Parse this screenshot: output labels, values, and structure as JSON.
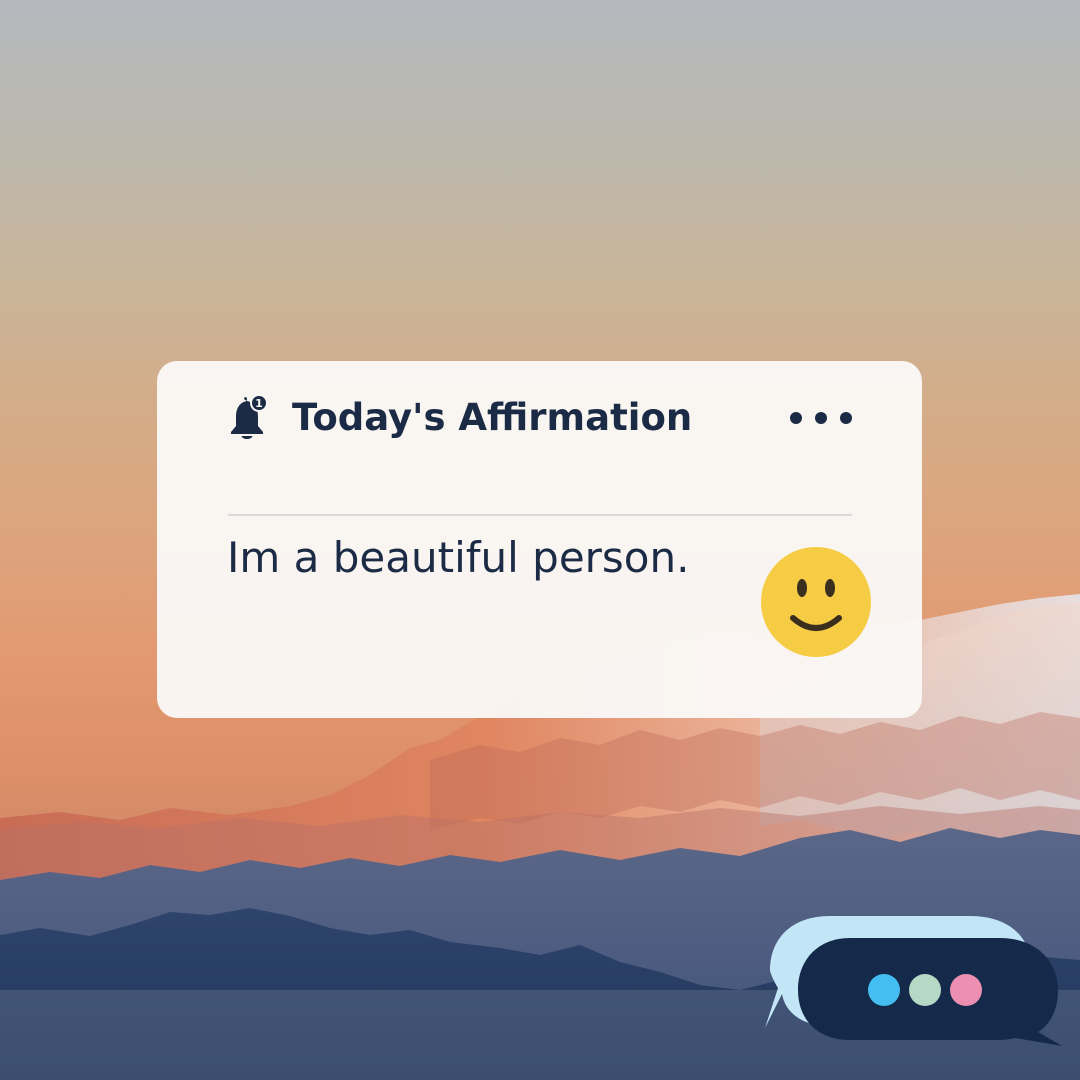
{
  "card": {
    "title": "Today's Affirmation",
    "message": "Im a beautiful person.",
    "notification_count": "1"
  },
  "icons": {
    "bell": "bell-icon",
    "more": "more-horizontal-icon",
    "smiley": "smiley-face-icon",
    "chat": "chat-bubble-icon"
  },
  "colors": {
    "text_dark": "#1c2b45",
    "card_bg": "#faf8f6",
    "smiley": "#f6cc45",
    "chat_dark": "#152a4a",
    "chat_light": "#c3e6f6",
    "dot_blue": "#44bdf0",
    "dot_green": "#b6d9c5",
    "dot_pink": "#ec8fb0"
  }
}
